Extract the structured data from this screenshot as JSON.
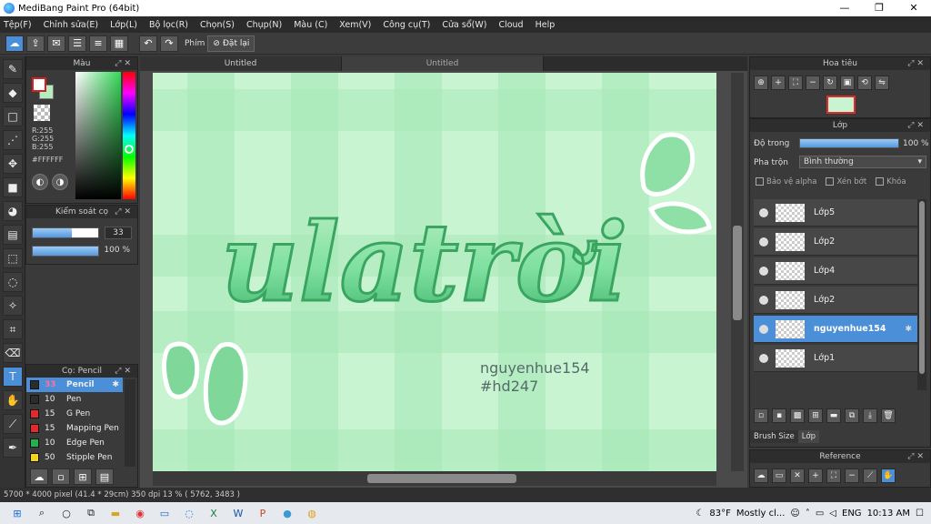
{
  "app": {
    "title": "MediBang Paint Pro (64bit)"
  },
  "window_controls": {
    "minimize": "—",
    "maximize": "❐",
    "close": "✕"
  },
  "menu": [
    "Tệp(F)",
    "Chỉnh sửa(E)",
    "Lớp(L)",
    "Bộ lọc(R)",
    "Chọn(S)",
    "Chụp(N)",
    "Màu (C)",
    "Xem(V)",
    "Công cụ(T)",
    "Cửa sổ(W)",
    "Cloud",
    "Help"
  ],
  "toolbar": {
    "shortcut_label": "Phím",
    "reset_label": "Đặt lại"
  },
  "color_panel": {
    "title": "Màu",
    "r": "R:255",
    "g": "G:255",
    "b": "B:255",
    "hex": "#FFFFFF",
    "main_color": "#ffffff",
    "sub_color": "#b5ecc0"
  },
  "brush_control": {
    "title": "Kiểm soát cọ",
    "size_value": "33",
    "size_fill": 0.6,
    "opacity_value": "100 %",
    "opacity_fill": 1.0
  },
  "brush_list": {
    "title": "Cọ: Pencil",
    "items": [
      {
        "num": "33",
        "name": "Pencil",
        "color": "#2c2c2c",
        "selected": true
      },
      {
        "num": "10",
        "name": "Pen",
        "color": "#2c2c2c"
      },
      {
        "num": "15",
        "name": "G Pen",
        "color": "#e02b2b"
      },
      {
        "num": "15",
        "name": "Mapping Pen",
        "color": "#e02b2b"
      },
      {
        "num": "10",
        "name": "Edge Pen",
        "color": "#22b14c"
      },
      {
        "num": "50",
        "name": "Stipple Pen",
        "color": "#f2d21c"
      }
    ]
  },
  "tabs": [
    "Untitled",
    "Untitled"
  ],
  "canvas": {
    "lettering": "ulatrời",
    "signature": "nguyenhue154",
    "hashtag": "#hd247"
  },
  "status": "5700 * 4000 pixel  (41.4 * 29cm)  350 dpi  13 %  ( 5762, 3483 )",
  "navigator": {
    "title": "Hoa tiêu"
  },
  "layers": {
    "title": "Lớp",
    "opacity_label": "Độ trong",
    "opacity_value": "100 %",
    "blend_label": "Pha trộn",
    "blend_value": "Bình thường",
    "protect_alpha": "Bảo vệ alpha",
    "clipping": "Xén bớt",
    "lock": "Khóa",
    "items": [
      {
        "name": "Lớp5",
        "selected": false
      },
      {
        "name": "Lớp2",
        "selected": false
      },
      {
        "name": "Lớp4",
        "selected": false
      },
      {
        "name": "Lớp2",
        "selected": false
      },
      {
        "name": "nguyenhue154",
        "selected": true
      },
      {
        "name": "Lớp1",
        "selected": false
      }
    ],
    "bottom_tabs": [
      "Brush Size",
      "Lớp"
    ]
  },
  "reference": {
    "title": "Reference"
  },
  "taskbar": {
    "weather_temp": "83°F",
    "weather_text": "Mostly cl...",
    "lang": "ENG",
    "time": "10:13 AM"
  }
}
